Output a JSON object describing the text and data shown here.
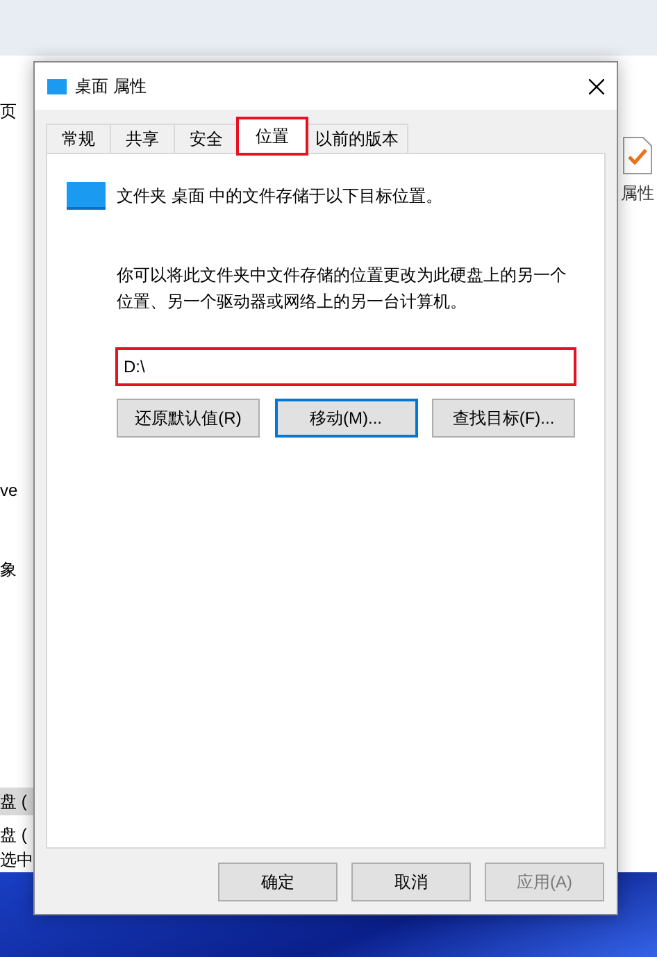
{
  "background_window": {
    "left_fragments": [
      {
        "text": "页",
        "selected": false
      },
      {
        "text": "ve",
        "selected": false
      },
      {
        "text": "象",
        "selected": false
      },
      {
        "text": "盘 (",
        "selected": true
      },
      {
        "text": "盘 (",
        "selected": false
      },
      {
        "text": "选中",
        "selected": false
      }
    ],
    "right_button": {
      "label": "属性"
    }
  },
  "dialog": {
    "title": "桌面 属性",
    "tabs": [
      {
        "label": "常规",
        "selected": false,
        "highlighted": false
      },
      {
        "label": "共享",
        "selected": false,
        "highlighted": false
      },
      {
        "label": "安全",
        "selected": false,
        "highlighted": false
      },
      {
        "label": "位置",
        "selected": true,
        "highlighted": true
      },
      {
        "label": "以前的版本",
        "selected": false,
        "highlighted": false
      }
    ],
    "heading": "文件夹 桌面 中的文件存储于以下目标位置。",
    "description": "你可以将此文件夹中文件存储的位置更改为此硬盘上的另一个位置、另一个驱动器或网络上的另一台计算机。",
    "path_field": {
      "value": "D:\\",
      "highlighted": true
    },
    "actions": [
      {
        "label": "还原默认值(R)",
        "focused": false
      },
      {
        "label": "移动(M)...",
        "focused": true
      },
      {
        "label": "查找目标(F)...",
        "focused": false
      }
    ],
    "buttons": [
      {
        "label": "确定",
        "disabled": false
      },
      {
        "label": "取消",
        "disabled": false
      },
      {
        "label": "应用(A)",
        "disabled": true
      }
    ]
  }
}
